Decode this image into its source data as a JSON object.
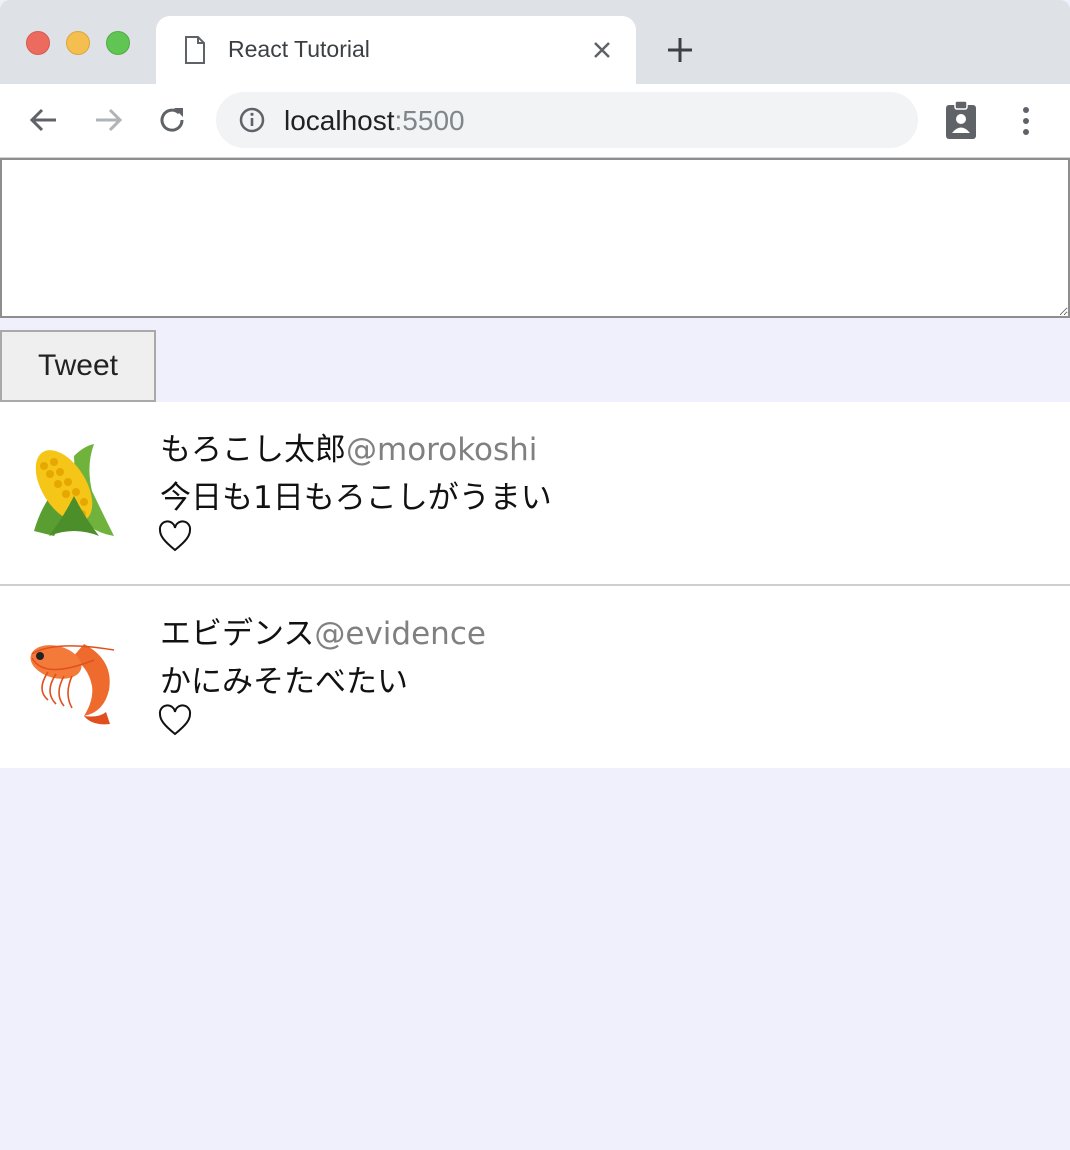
{
  "browser": {
    "tab_title": "React Tutorial",
    "url_host": "localhost",
    "url_port": ":5500",
    "icons": {
      "back": "arrow-left-icon",
      "forward": "arrow-right-icon",
      "reload": "reload-icon",
      "info": "info-icon",
      "extension": "clipboard-user-icon",
      "menu": "kebab-menu-icon",
      "close_tab": "close-icon",
      "new_tab": "plus-icon"
    }
  },
  "composer": {
    "textarea_value": "",
    "tweet_button": "Tweet"
  },
  "tweets": [
    {
      "avatar": "corn-icon",
      "display_name": "もろこし太郎",
      "handle": "@morokoshi",
      "text": "今日も1日もろこしがうまい",
      "liked": false
    },
    {
      "avatar": "shrimp-icon",
      "display_name": "エビデンス",
      "handle": "@evidence",
      "text": "かにみそたべたい",
      "liked": false
    }
  ],
  "colors": {
    "page_background": "#f0f0fc",
    "handle_gray": "#808080"
  }
}
